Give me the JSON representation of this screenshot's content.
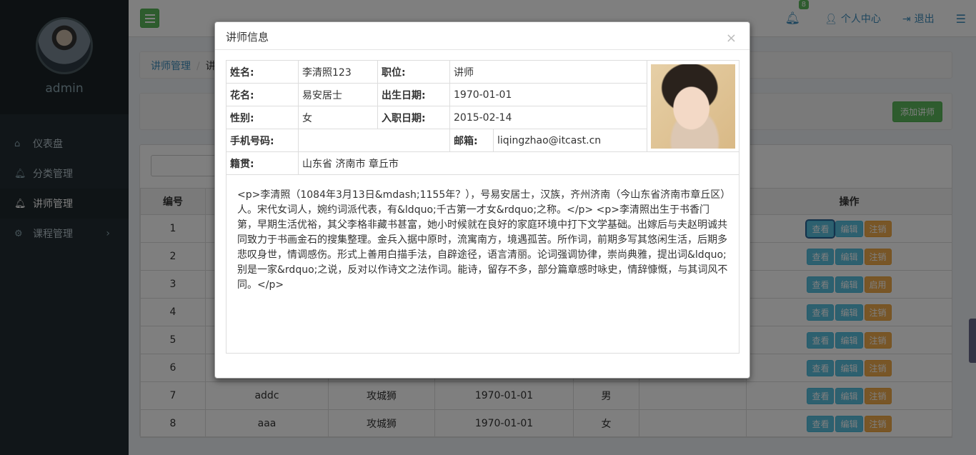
{
  "sidebar": {
    "username": "admin",
    "items": [
      {
        "label": "仪表盘",
        "icon": "home-icon"
      },
      {
        "label": "分类管理",
        "icon": "bell-icon"
      },
      {
        "label": "讲师管理",
        "icon": "bell-icon"
      },
      {
        "label": "课程管理",
        "icon": "gear-icon"
      }
    ]
  },
  "topbar": {
    "notification_count": "8",
    "profile_label": "个人中心",
    "logout_label": "退出"
  },
  "breadcrumb": {
    "root": "讲师管理",
    "current": "讲"
  },
  "toolbar": {
    "add_label": "添加讲师"
  },
  "table": {
    "headers": [
      "编号",
      "操作"
    ],
    "rows": [
      {
        "no": "1",
        "name": "",
        "title": "",
        "birth": "",
        "gender": "",
        "actions": [
          "查看",
          "编辑",
          "注销"
        ]
      },
      {
        "no": "2",
        "name": "",
        "title": "",
        "birth": "",
        "gender": "",
        "actions": [
          "查看",
          "编辑",
          "注销"
        ]
      },
      {
        "no": "3",
        "name": "",
        "title": "",
        "birth": "",
        "gender": "",
        "actions": [
          "查看",
          "编辑",
          "启用"
        ]
      },
      {
        "no": "4",
        "name": "",
        "title": "",
        "birth": "",
        "gender": "",
        "actions": [
          "查看",
          "编辑",
          "注销"
        ]
      },
      {
        "no": "5",
        "name": "",
        "title": "",
        "birth": "",
        "gender": "",
        "actions": [
          "查看",
          "编辑",
          "注销"
        ]
      },
      {
        "no": "6",
        "name": "",
        "title": "",
        "birth": "",
        "gender": "",
        "actions": [
          "查看",
          "编辑",
          "注销"
        ]
      },
      {
        "no": "7",
        "name": "addc",
        "title": "攻城狮",
        "birth": "1970-01-01",
        "gender": "男",
        "actions": [
          "查看",
          "编辑",
          "注销"
        ]
      },
      {
        "no": "8",
        "name": "aaa",
        "title": "攻城狮",
        "birth": "1970-01-01",
        "gender": "女",
        "actions": [
          "查看",
          "编辑",
          "注销"
        ]
      }
    ]
  },
  "modal": {
    "title": "讲师信息",
    "close": "×",
    "fields": {
      "name_label": "姓名:",
      "name_value": "李清照123",
      "position_label": "职位:",
      "position_value": "讲师",
      "alias_label": "花名:",
      "alias_value": "易安居士",
      "birth_label": "出生日期:",
      "birth_value": "1970-01-01",
      "gender_label": "性别:",
      "gender_value": "女",
      "join_label": "入职日期:",
      "join_value": "2015-02-14",
      "phone_label": "手机号码:",
      "phone_value": "",
      "email_label": "邮箱:",
      "email_value": "liqingzhao@itcast.cn",
      "origin_label": "籍贯:",
      "origin_value": "山东省 济南市 章丘市"
    },
    "description": "<p>李清照（1084年3月13日&mdash;1155年？），号易安居士，汉族，齐州济南（今山东省济南市章丘区）人。宋代女词人，婉约词派代表，有&ldquo;千古第一才女&rdquo;之称。</p> <p>李清照出生于书香门第，早期生活优裕，其父李格非藏书甚富，她小时候就在良好的家庭环境中打下文学基础。出嫁后与夫赵明诚共同致力于书画金石的搜集整理。金兵入据中原时，流寓南方，境遇孤苦。所作词，前期多写其悠闲生活，后期多悲叹身世，情调感伤。形式上善用白描手法，自辟途径，语言清丽。论词强调协律，崇尚典雅，提出词&ldquo;别是一家&rdquo;之说，反对以作诗文之法作词。能诗，留存不多，部分篇章感时咏史，情辞慷慨，与其词风不同。</p>"
  }
}
